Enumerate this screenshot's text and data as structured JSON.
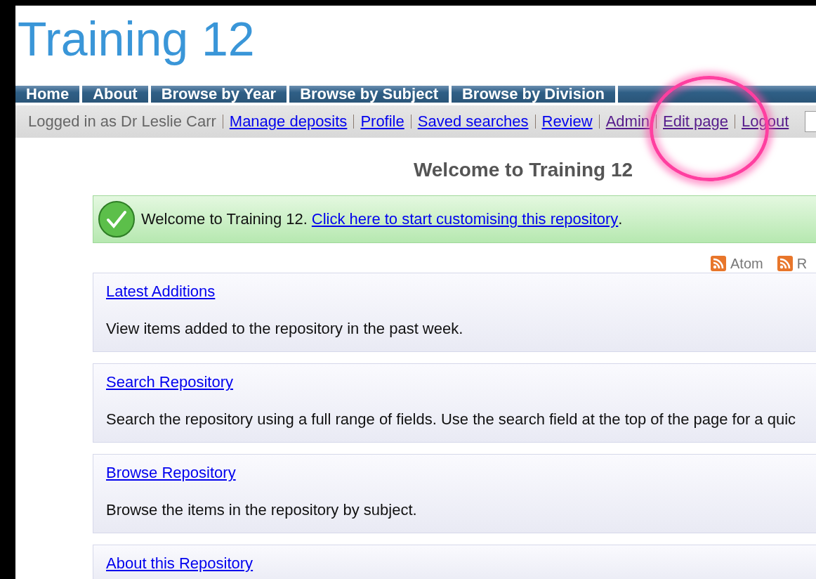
{
  "site_title": "Training 12",
  "nav": [
    "Home",
    "About",
    "Browse by Year",
    "Browse by Subject",
    "Browse by Division"
  ],
  "login_bar": {
    "prefix": "Logged in as Dr Leslie Carr",
    "links": [
      {
        "label": "Manage deposits",
        "visited": false
      },
      {
        "label": "Profile",
        "visited": false
      },
      {
        "label": "Saved searches",
        "visited": false
      },
      {
        "label": "Review",
        "visited": false
      },
      {
        "label": "Admin",
        "visited": true
      },
      {
        "label": "Edit page",
        "visited": true
      },
      {
        "label": "Logout",
        "visited": true
      }
    ]
  },
  "heading": "Welcome to Training 12",
  "message": {
    "text": "Welcome to Training 12.",
    "link": "Click here to start customising this repository",
    "suffix": "."
  },
  "feeds": [
    "Atom",
    "R"
  ],
  "cards": [
    {
      "title": "Latest Additions",
      "text": "View items added to the repository in the past week."
    },
    {
      "title": "Search Repository",
      "text": "Search the repository using a full range of fields. Use the search field at the top of the page for a quic"
    },
    {
      "title": "Browse Repository",
      "text": "Browse the items in the repository by subject."
    },
    {
      "title": "About this Repository"
    }
  ]
}
